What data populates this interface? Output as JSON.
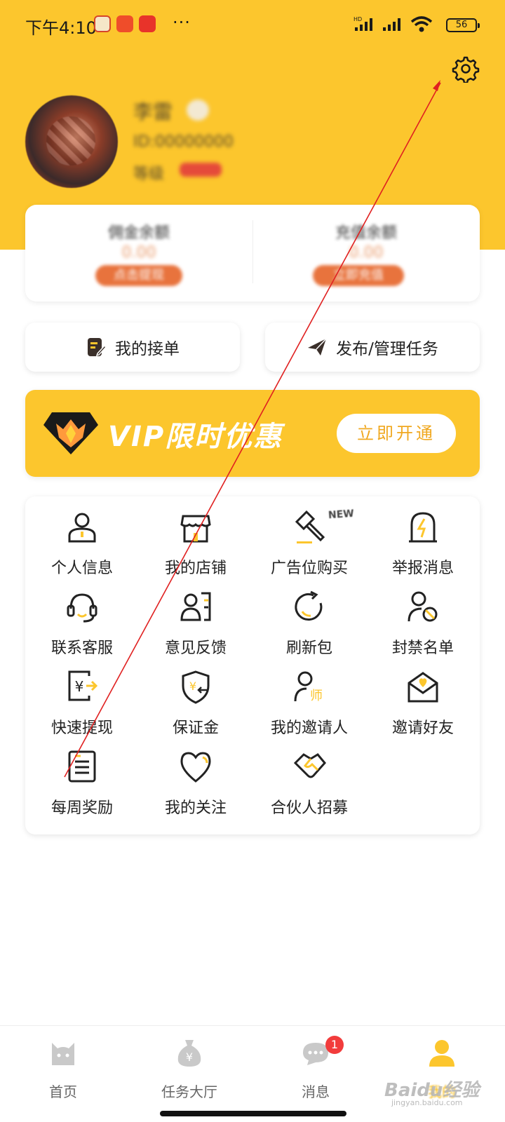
{
  "status_bar": {
    "time": "下午4:10",
    "more": "···",
    "battery": "56"
  },
  "profile": {
    "name": "李雷",
    "id_text": "ID:00000000",
    "level": "等级"
  },
  "balance": {
    "left_title": "佣金余额",
    "left_value": "0.00",
    "left_button": "点击提现",
    "right_title": "充值余额",
    "right_value": "0.00",
    "right_button": "立即充值"
  },
  "actions": {
    "my_orders": "我的接单",
    "publish_tasks": "发布/管理任务"
  },
  "vip": {
    "title": "VIP限时优惠",
    "button": "立即开通"
  },
  "grid": {
    "badge_new": "NEW",
    "items": [
      {
        "label": "个人信息",
        "icon": "person-icon"
      },
      {
        "label": "我的店铺",
        "icon": "store-icon"
      },
      {
        "label": "广告位购买",
        "icon": "hammer-icon"
      },
      {
        "label": "举报消息",
        "icon": "report-icon"
      },
      {
        "label": "联系客服",
        "icon": "headset-icon"
      },
      {
        "label": "意见反馈",
        "icon": "feedback-icon"
      },
      {
        "label": "刷新包",
        "icon": "refresh-icon"
      },
      {
        "label": "封禁名单",
        "icon": "blocked-user-icon"
      },
      {
        "label": "快速提现",
        "icon": "withdraw-icon"
      },
      {
        "label": "保证金",
        "icon": "shield-yen-icon"
      },
      {
        "label": "我的邀请人",
        "icon": "mentor-icon"
      },
      {
        "label": "邀请好友",
        "icon": "invite-mail-icon"
      },
      {
        "label": "每周奖励",
        "icon": "weekly-reward-icon"
      },
      {
        "label": "我的关注",
        "icon": "heart-icon"
      },
      {
        "label": "合伙人招募",
        "icon": "handshake-icon"
      }
    ]
  },
  "nav": {
    "items": [
      {
        "label": "首页",
        "icon": "home-cat-icon"
      },
      {
        "label": "任务大厅",
        "icon": "money-bag-icon"
      },
      {
        "label": "消息",
        "icon": "chat-icon",
        "badge": "1"
      },
      {
        "label": "我的",
        "icon": "user-icon"
      }
    ]
  },
  "watermark": {
    "text": "Baidu经验",
    "sub": "jingyan.baidu.com"
  },
  "colors": {
    "brand_yellow": "#fcc62d",
    "accent_orange": "#e8733d",
    "badge_red": "#f23c3c",
    "annotation_red": "#e02020"
  }
}
